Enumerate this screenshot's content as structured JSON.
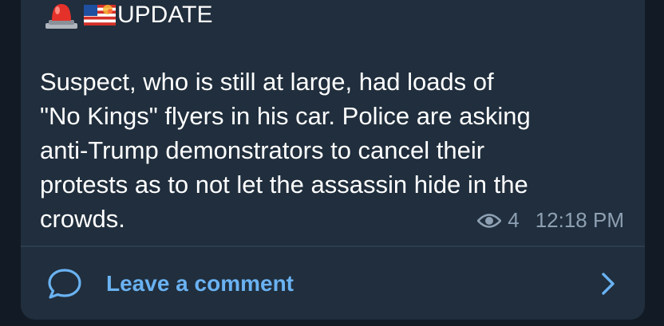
{
  "post": {
    "header_text": "UPDATE",
    "header_emoji": [
      "siren-icon",
      "us-flag-fireworks-icon"
    ],
    "body": "Suspect, who is still at large, had loads of\n\"No Kings\" flyers in his car. Police are asking\nanti-Trump demonstrators to cancel their\nprotests as to not let the assassin hide in the\ncrowds.",
    "views": "4",
    "time": "12:18 PM"
  },
  "comments": {
    "label": "Leave a comment"
  },
  "colors": {
    "bubble": "#202e3d",
    "text": "#ffffff",
    "meta": "#8ea0b3",
    "link": "#6ab2f2"
  }
}
